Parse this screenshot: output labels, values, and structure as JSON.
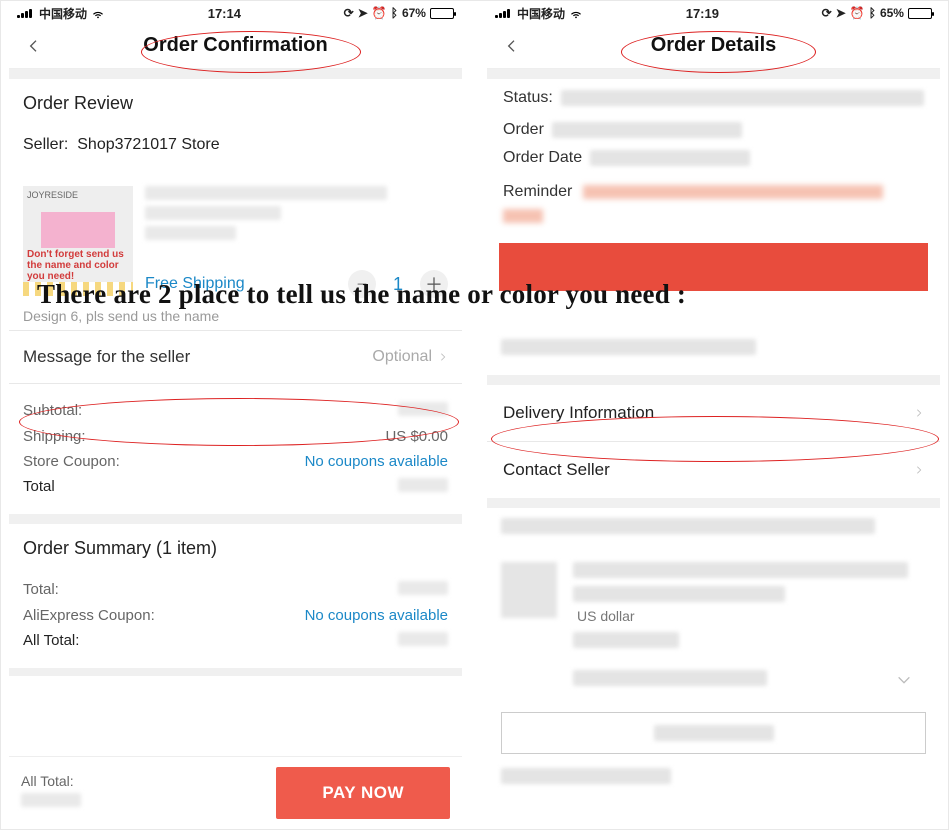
{
  "left": {
    "status": {
      "carrier": "中国移动",
      "time": "17:14",
      "battery_pct": "67%"
    },
    "nav_title": "Order Confirmation",
    "review_title": "Order Review",
    "seller_label": "Seller:",
    "seller_name": "Shop3721017 Store",
    "thumb": {
      "top_text": "JOYRESIDE",
      "bottom_text": "Don't forget send us the name and color you need!"
    },
    "free_shipping": "Free Shipping",
    "quantity": "1",
    "variant_note": "Design 6, pls send us the name",
    "message_seller_label": "Message for the seller",
    "message_seller_hint": "Optional",
    "subtotal_label": "Subtotal:",
    "shipping_label": "Shipping:",
    "shipping_value": "US $0.00",
    "store_coupon_label": "Store Coupon:",
    "no_coupons": "No coupons available",
    "total_label": "Total",
    "summary_title": "Order Summary (1 item)",
    "summary_total_label": "Total:",
    "ali_coupon_label": "AliExpress Coupon:",
    "all_total_label": "All Total:",
    "footer_all_total": "All Total:",
    "pay_now": "PAY NOW"
  },
  "right": {
    "status": {
      "carrier": "中国移动",
      "time": "17:19",
      "battery_pct": "65%"
    },
    "nav_title": "Order Details",
    "status_label": "Status:",
    "order_label": "Order",
    "order_date_label": "Order Date",
    "reminder_label": "Reminder",
    "delivery_info": "Delivery Information",
    "contact_seller": "Contact Seller",
    "currency_note": "US dollar"
  },
  "overlay_heading": "There are 2 place to tell us the name or color you need :"
}
